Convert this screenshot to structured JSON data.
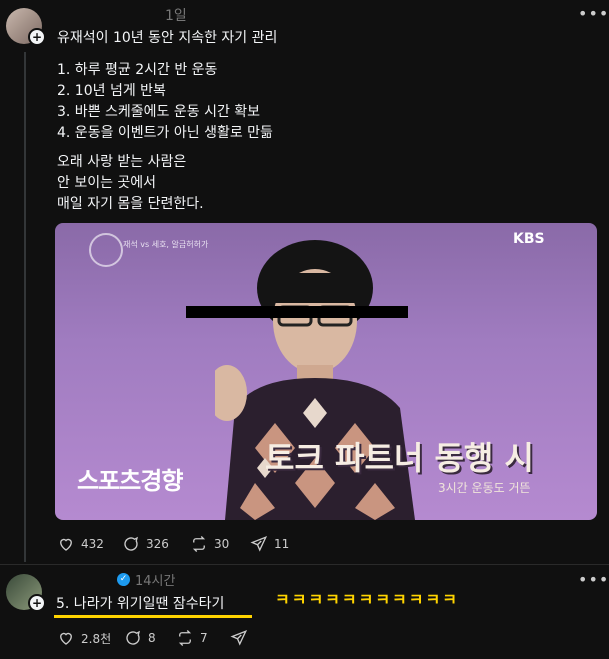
{
  "post1": {
    "username": "",
    "time": "1일",
    "title": "유재석이 10년 동안 지속한 자기 관리",
    "list": [
      "1. 하루 평균 2시간 반 운동",
      "2. 10년 넘게 반복",
      "3. 바쁜 스케줄에도 운동 시간 확보",
      "4. 운동을 이벤트가 아닌 생활로 만듦"
    ],
    "paragraph": [
      "오래 사랑 받는 사람은",
      "안 보이는 곳에서",
      "매일 자기 몸을 단련한다."
    ],
    "image": {
      "logo_top_left": "재석 vs 세호, 알금허허가",
      "broadcaster": "KBS",
      "watermark": "스포츠경향",
      "caption_main": "토크 파트너 동행 시",
      "caption_sub": "3시간 운동도 거뜬"
    },
    "stats": {
      "likes": "432",
      "comments": "326",
      "reposts": "30",
      "shares": "11"
    }
  },
  "post2": {
    "username": "",
    "time": "14시간",
    "text": "5. 나라가 위기일땐 잠수타기",
    "laughs": "ㅋㅋㅋㅋㅋㅋㅋㅋㅋㅋㅋ",
    "stats": {
      "likes": "2.8천",
      "comments": "8",
      "reposts": "7"
    }
  },
  "colors": {
    "bg": "#101010",
    "verified": "#1d9bf0",
    "highlight": "#ffd400"
  },
  "icons": [
    "more-icon",
    "heart-icon",
    "comment-icon",
    "repost-icon",
    "share-icon",
    "verified-icon",
    "plus-icon"
  ]
}
